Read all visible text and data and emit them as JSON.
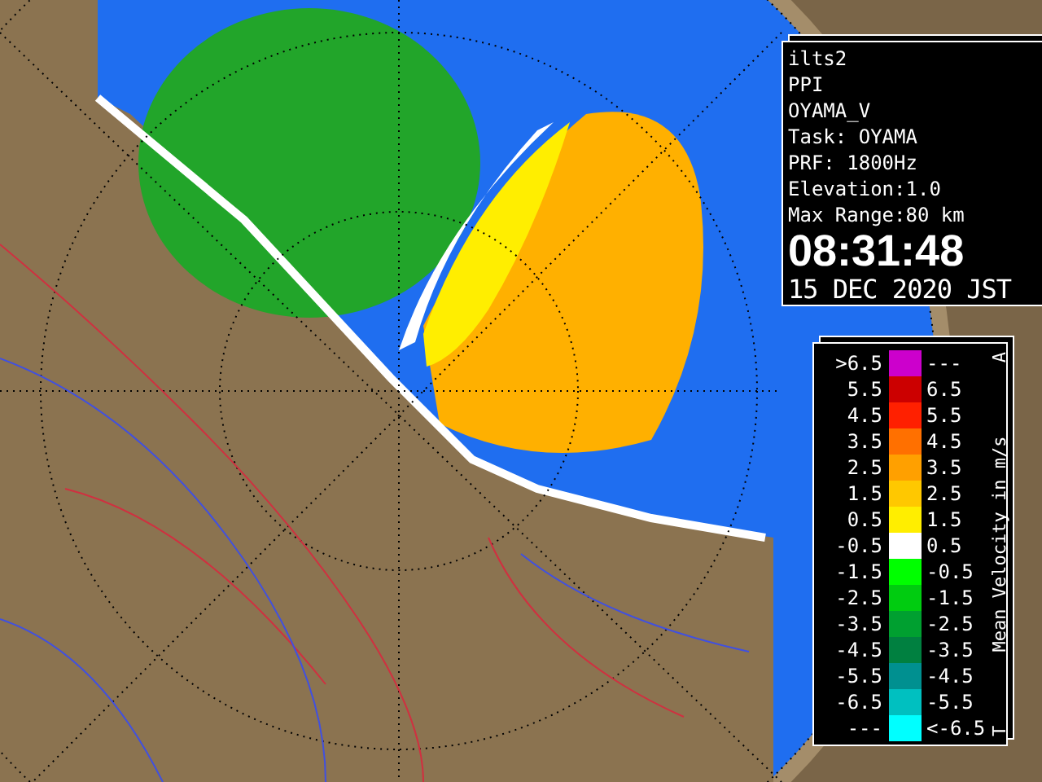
{
  "info_panel": {
    "lines": [
      "ilts2",
      "PPI",
      "OYAMA_V",
      "Task: OYAMA",
      "PRF: 1800Hz",
      "Elevation:1.0",
      "Max Range:80 km"
    ],
    "time": "08:31:48",
    "date": "15 DEC 2020 JST"
  },
  "legend": {
    "title": "Mean Velocity in m/s",
    "top_mark": "A",
    "bottom_mark": "T",
    "rows": [
      {
        "low": ">6.5",
        "high": "---",
        "color": "#cc00cc"
      },
      {
        "low": "5.5",
        "high": "6.5",
        "color": "#cc0000"
      },
      {
        "low": "4.5",
        "high": "5.5",
        "color": "#ff2000"
      },
      {
        "low": "3.5",
        "high": "4.5",
        "color": "#ff7000"
      },
      {
        "low": "2.5",
        "high": "3.5",
        "color": "#ffa000"
      },
      {
        "low": "1.5",
        "high": "2.5",
        "color": "#ffc800"
      },
      {
        "low": "0.5",
        "high": "1.5",
        "color": "#ffee00"
      },
      {
        "low": "-0.5",
        "high": "0.5",
        "color": "#ffffff"
      },
      {
        "low": "-1.5",
        "high": "-0.5",
        "color": "#00ff00"
      },
      {
        "low": "-2.5",
        "high": "-1.5",
        "color": "#00cc10"
      },
      {
        "low": "-3.5",
        "high": "-2.5",
        "color": "#00a030"
      },
      {
        "low": "-4.5",
        "high": "-3.5",
        "color": "#008040"
      },
      {
        "low": "-5.5",
        "high": "-4.5",
        "color": "#009090"
      },
      {
        "low": "-6.5",
        "high": "-5.5",
        "color": "#00c0c0"
      },
      {
        "low": "---",
        "high": "<-6.5",
        "color": "#00ffff"
      }
    ]
  }
}
